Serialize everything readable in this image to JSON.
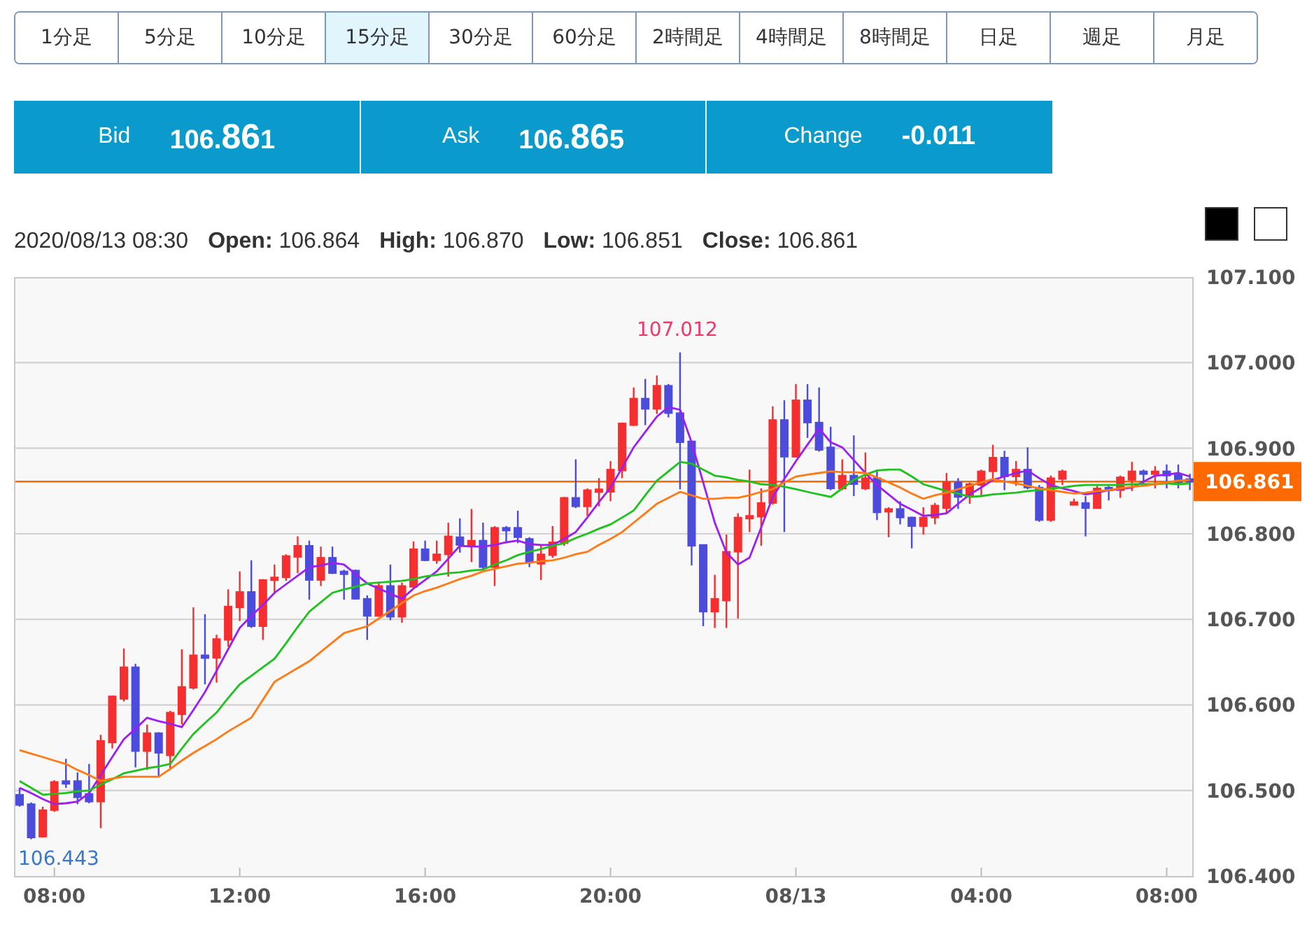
{
  "timeframe_tabs": [
    {
      "label": "1分足",
      "selected": false
    },
    {
      "label": "5分足",
      "selected": false
    },
    {
      "label": "10分足",
      "selected": false
    },
    {
      "label": "15分足",
      "selected": true
    },
    {
      "label": "30分足",
      "selected": false
    },
    {
      "label": "60分足",
      "selected": false
    },
    {
      "label": "2時間足",
      "selected": false
    },
    {
      "label": "4時間足",
      "selected": false
    },
    {
      "label": "8時間足",
      "selected": false
    },
    {
      "label": "日足",
      "selected": false
    },
    {
      "label": "週足",
      "selected": false
    },
    {
      "label": "月足",
      "selected": false
    }
  ],
  "quote_bar": [
    {
      "label": "Bid",
      "value": {
        "head": "106.",
        "pips": "86",
        "tail": "1"
      }
    },
    {
      "label": "Ask",
      "value": {
        "head": "106.",
        "pips": "86",
        "tail": "5"
      }
    },
    {
      "label": "Change",
      "value": {
        "head": "-0.011"
      }
    }
  ],
  "ohlc_info": {
    "timestamp": "2020/08/13 08:30",
    "fields": [
      {
        "label": "Open:",
        "value": "106.864"
      },
      {
        "label": "High:",
        "value": "106.870"
      },
      {
        "label": "Low:",
        "value": "106.851"
      },
      {
        "label": "Close:",
        "value": "106.861"
      }
    ]
  },
  "theme_swatches": [
    {
      "color": "#000000"
    },
    {
      "color": "#ffffff"
    }
  ],
  "chart": {
    "high_label": "107.012",
    "low_label": "106.443",
    "chart_data": {
      "type": "candlestick",
      "grid": true,
      "ylim": [
        106.4,
        107.1
      ],
      "ref_lines": [
        {
          "axis": "y",
          "value": 106.861,
          "label": "106.861",
          "color": "#ff6a00"
        }
      ],
      "yticks": [
        {
          "value": 107.1,
          "label": "107.100"
        },
        {
          "value": 107.0,
          "label": "107.000"
        },
        {
          "value": 106.9,
          "label": "106.900"
        },
        {
          "value": 106.8,
          "label": "106.800"
        },
        {
          "value": 106.7,
          "label": "106.700"
        },
        {
          "value": 106.6,
          "label": "106.600"
        },
        {
          "value": 106.5,
          "label": "106.500"
        },
        {
          "value": 106.4,
          "label": "106.400"
        }
      ],
      "categories": [
        null,
        null,
        null,
        "08:00",
        null,
        null,
        null,
        null,
        null,
        null,
        null,
        null,
        null,
        null,
        null,
        null,
        null,
        null,
        null,
        "12:00",
        null,
        null,
        null,
        null,
        null,
        null,
        null,
        null,
        null,
        null,
        null,
        null,
        null,
        null,
        null,
        "16:00",
        null,
        null,
        null,
        null,
        null,
        null,
        null,
        null,
        null,
        null,
        null,
        null,
        null,
        null,
        null,
        "20:00",
        null,
        null,
        null,
        null,
        null,
        null,
        null,
        null,
        null,
        null,
        null,
        null,
        null,
        null,
        null,
        "08/13",
        null,
        null,
        null,
        null,
        null,
        null,
        null,
        null,
        null,
        null,
        null,
        null,
        null,
        null,
        null,
        "04:00",
        null,
        null,
        null,
        null,
        null,
        null,
        null,
        null,
        null,
        null,
        null,
        null,
        null,
        null,
        null,
        "08:00",
        null,
        null
      ],
      "series": [
        {
          "ohlc": [
            [
              106.495,
              106.503,
              106.481,
              106.483
            ],
            [
              106.484,
              106.486,
              106.443,
              106.445
            ],
            [
              106.446,
              106.481,
              106.445,
              106.477
            ],
            [
              106.477,
              106.512,
              106.475,
              106.51
            ],
            [
              106.511,
              106.537,
              106.503,
              106.508
            ],
            [
              106.511,
              106.521,
              106.484,
              106.492
            ],
            [
              106.496,
              106.531,
              106.485,
              106.487
            ],
            [
              106.487,
              106.565,
              106.456,
              106.558
            ],
            [
              106.556,
              106.611,
              106.549,
              106.61
            ],
            [
              106.607,
              106.666,
              106.604,
              106.644
            ],
            [
              106.644,
              106.648,
              106.527,
              106.546
            ],
            [
              106.546,
              106.577,
              106.524,
              106.567
            ],
            [
              106.567,
              106.568,
              106.516,
              106.544
            ],
            [
              106.541,
              106.593,
              106.525,
              106.591
            ],
            [
              106.589,
              106.665,
              106.577,
              106.621
            ],
            [
              106.62,
              106.714,
              106.618,
              106.658
            ],
            [
              106.658,
              106.706,
              106.624,
              106.655
            ],
            [
              106.655,
              106.682,
              106.626,
              106.677
            ],
            [
              106.676,
              106.735,
              106.668,
              106.715
            ],
            [
              106.714,
              106.756,
              106.698,
              106.732
            ],
            [
              106.732,
              106.769,
              106.69,
              106.692
            ],
            [
              106.692,
              106.747,
              106.676,
              106.746
            ],
            [
              106.746,
              106.764,
              106.731,
              106.749
            ],
            [
              106.749,
              106.776,
              106.745,
              106.774
            ],
            [
              106.773,
              106.797,
              106.754,
              106.786
            ],
            [
              106.786,
              106.792,
              106.723,
              106.746
            ],
            [
              106.746,
              106.785,
              106.739,
              106.772
            ],
            [
              106.772,
              106.785,
              106.753,
              106.754
            ],
            [
              106.756,
              106.758,
              106.723,
              106.754
            ],
            [
              106.757,
              106.758,
              106.723,
              106.724
            ],
            [
              106.724,
              106.728,
              106.676,
              106.704
            ],
            [
              106.704,
              106.742,
              106.703,
              106.739
            ],
            [
              106.739,
              106.764,
              106.699,
              106.703
            ],
            [
              106.703,
              106.743,
              106.696,
              106.739
            ],
            [
              106.738,
              106.791,
              106.736,
              106.782
            ],
            [
              106.782,
              106.792,
              106.768,
              106.769
            ],
            [
              106.769,
              106.792,
              106.765,
              106.776
            ],
            [
              106.776,
              106.813,
              106.75,
              106.797
            ],
            [
              106.796,
              106.818,
              106.778,
              106.787
            ],
            [
              106.786,
              106.829,
              106.767,
              106.792
            ],
            [
              106.792,
              106.813,
              106.758,
              106.761
            ],
            [
              106.761,
              106.809,
              106.739,
              106.807
            ],
            [
              106.807,
              106.809,
              106.789,
              106.805
            ],
            [
              106.807,
              106.827,
              106.789,
              106.796
            ],
            [
              106.794,
              106.796,
              106.761,
              106.767
            ],
            [
              106.765,
              106.786,
              106.746,
              106.776
            ],
            [
              106.775,
              106.809,
              106.772,
              106.79
            ],
            [
              106.789,
              106.843,
              106.786,
              106.842
            ],
            [
              106.842,
              106.887,
              106.83,
              106.832
            ],
            [
              106.832,
              106.853,
              106.821,
              106.851
            ],
            [
              106.849,
              106.865,
              106.832,
              106.852
            ],
            [
              106.849,
              106.885,
              106.838,
              106.875
            ],
            [
              106.874,
              106.93,
              106.865,
              106.929
            ],
            [
              106.927,
              106.971,
              106.926,
              106.958
            ],
            [
              106.958,
              106.981,
              106.927,
              106.946
            ],
            [
              106.946,
              106.985,
              106.94,
              106.973
            ],
            [
              106.973,
              106.975,
              106.936,
              106.941
            ],
            [
              106.941,
              107.012,
              106.852,
              106.907
            ],
            [
              106.908,
              106.909,
              106.763,
              106.786
            ],
            [
              106.787,
              106.787,
              106.692,
              106.709
            ],
            [
              106.709,
              106.752,
              106.69,
              106.724
            ],
            [
              106.722,
              106.799,
              106.69,
              106.779
            ],
            [
              106.779,
              106.824,
              106.701,
              106.819
            ],
            [
              106.819,
              106.875,
              106.802,
              106.821
            ],
            [
              106.82,
              106.853,
              106.786,
              106.836
            ],
            [
              106.836,
              106.949,
              106.834,
              106.933
            ],
            [
              106.933,
              106.956,
              106.802,
              106.89
            ],
            [
              106.89,
              106.975,
              106.889,
              106.956
            ],
            [
              106.956,
              106.975,
              106.912,
              106.93
            ],
            [
              106.93,
              106.971,
              106.896,
              106.898
            ],
            [
              106.901,
              106.925,
              106.851,
              106.853
            ],
            [
              106.853,
              106.887,
              106.851,
              106.868
            ],
            [
              106.868,
              106.915,
              106.844,
              106.858
            ],
            [
              106.853,
              106.895,
              106.851,
              106.865
            ],
            [
              106.865,
              106.875,
              106.816,
              106.825
            ],
            [
              106.826,
              106.831,
              106.796,
              106.829
            ],
            [
              106.829,
              106.838,
              106.811,
              106.819
            ],
            [
              106.819,
              106.82,
              106.783,
              106.809
            ],
            [
              106.809,
              106.831,
              106.799,
              106.819
            ],
            [
              106.819,
              106.836,
              106.811,
              106.833
            ],
            [
              106.83,
              106.871,
              106.824,
              106.86
            ],
            [
              106.86,
              106.865,
              106.829,
              106.843
            ],
            [
              106.843,
              106.86,
              106.835,
              106.858
            ],
            [
              106.857,
              106.875,
              106.843,
              106.873
            ],
            [
              106.873,
              106.904,
              106.863,
              106.889
            ],
            [
              106.889,
              106.897,
              106.851,
              106.867
            ],
            [
              106.867,
              106.885,
              106.856,
              106.875
            ],
            [
              106.875,
              106.901,
              106.852,
              106.854
            ],
            [
              106.854,
              106.857,
              106.814,
              106.816
            ],
            [
              106.816,
              106.868,
              106.814,
              106.865
            ],
            [
              106.864,
              106.875,
              106.857,
              106.873
            ],
            [
              106.835,
              106.841,
              106.834,
              106.837
            ],
            [
              106.836,
              106.844,
              106.797,
              106.83
            ],
            [
              106.83,
              106.856,
              106.83,
              106.853
            ],
            [
              106.854,
              106.856,
              106.839,
              106.851
            ],
            [
              106.851,
              106.868,
              106.842,
              106.866
            ],
            [
              106.863,
              106.884,
              106.85,
              106.873
            ],
            [
              106.873,
              106.875,
              106.857,
              106.871
            ],
            [
              106.87,
              106.879,
              106.853,
              106.873
            ],
            [
              106.873,
              106.881,
              106.853,
              106.868
            ],
            [
              106.869,
              106.881,
              106.853,
              106.86
            ],
            [
              106.864,
              106.87,
              106.851,
              106.861
            ]
          ]
        },
        {
          "type": "line",
          "color": "#9b1ff0",
          "values": [
            106.503,
            106.497,
            106.49,
            106.484,
            106.485,
            106.487,
            106.497,
            106.518,
            106.539,
            106.56,
            106.572,
            106.585,
            106.581,
            106.578,
            106.574,
            106.594,
            106.615,
            106.64,
            106.665,
            106.69,
            106.704,
            106.717,
            106.731,
            106.741,
            106.751,
            106.761,
            106.763,
            106.766,
            106.764,
            106.753,
            106.742,
            106.736,
            106.73,
            106.724,
            106.736,
            106.746,
            106.756,
            106.771,
            106.786,
            106.785,
            106.785,
            106.787,
            106.79,
            106.792,
            106.788,
            106.787,
            106.787,
            106.794,
            106.802,
            106.819,
            106.837,
            106.854,
            106.877,
            106.901,
            106.919,
            106.937,
            106.948,
            106.945,
            106.907,
            106.86,
            106.813,
            106.778,
            106.764,
            106.772,
            106.807,
            106.843,
            106.864,
            106.885,
            106.904,
            106.923,
            106.907,
            106.901,
            106.886,
            106.871,
            106.857,
            106.846,
            106.835,
            106.828,
            106.821,
            106.822,
            106.824,
            106.835,
            106.846,
            106.854,
            106.863,
            106.867,
            106.871,
            106.874,
            106.865,
            106.857,
            106.853,
            106.85,
            106.846,
            106.848,
            106.851,
            106.852,
            106.854,
            106.861,
            106.868,
            106.869,
            106.871,
            106.867
          ]
        },
        {
          "type": "line",
          "color": "#1ec21e",
          "values": [
            106.511,
            106.503,
            106.495,
            106.496,
            106.497,
            106.499,
            106.5,
            106.507,
            106.513,
            106.52,
            106.523,
            106.526,
            106.528,
            106.531,
            106.549,
            106.566,
            106.579,
            106.591,
            106.608,
            106.624,
            106.634,
            106.644,
            106.654,
            106.672,
            106.691,
            106.709,
            106.72,
            106.731,
            106.735,
            106.738,
            106.742,
            106.743,
            106.744,
            106.745,
            106.747,
            106.75,
            106.752,
            106.754,
            106.755,
            106.757,
            106.758,
            106.764,
            106.769,
            106.775,
            106.779,
            106.782,
            106.786,
            106.789,
            106.795,
            106.8,
            106.806,
            106.811,
            106.819,
            106.827,
            106.845,
            106.862,
            106.873,
            106.884,
            106.882,
            106.875,
            106.868,
            106.866,
            106.863,
            106.861,
            106.858,
            106.857,
            106.855,
            106.852,
            106.849,
            106.846,
            106.843,
            106.853,
            106.863,
            106.869,
            106.874,
            106.875,
            106.875,
            106.867,
            106.858,
            106.854,
            106.85,
            106.847,
            106.843,
            106.844,
            106.846,
            106.847,
            106.848,
            106.85,
            106.851,
            106.853,
            106.854,
            106.856,
            106.857,
            106.857,
            106.857,
            106.857,
            106.858,
            106.858,
            106.858,
            106.859,
            106.858,
            106.859
          ]
        },
        {
          "type": "line",
          "color": "#ff7a14",
          "values": [
            106.547,
            106.543,
            106.539,
            106.535,
            106.531,
            106.524,
            106.518,
            106.511,
            106.514,
            106.516,
            106.516,
            106.516,
            106.516,
            106.525,
            106.535,
            106.544,
            106.552,
            106.56,
            106.569,
            106.577,
            106.585,
            106.606,
            106.627,
            106.635,
            106.643,
            106.651,
            106.662,
            106.673,
            106.684,
            106.688,
            106.692,
            106.701,
            106.71,
            106.719,
            106.728,
            106.733,
            106.737,
            106.742,
            106.747,
            106.751,
            106.756,
            106.759,
            106.762,
            106.765,
            106.766,
            106.768,
            106.769,
            106.772,
            106.776,
            106.779,
            106.787,
            106.794,
            106.802,
            106.813,
            106.824,
            106.835,
            106.842,
            106.849,
            106.845,
            106.841,
            106.841,
            106.842,
            106.842,
            106.845,
            106.849,
            106.852,
            106.86,
            106.867,
            106.869,
            106.871,
            106.873,
            106.872,
            106.872,
            106.871,
            106.866,
            106.86,
            106.854,
            106.847,
            106.841,
            106.845,
            106.848,
            106.852,
            106.856,
            106.86,
            106.864,
            106.861,
            106.859,
            106.856,
            106.853,
            106.851,
            106.849,
            106.847,
            106.848,
            106.85,
            106.851,
            106.853,
            106.855,
            106.856,
            106.858,
            106.86,
            106.862,
            106.863
          ]
        }
      ]
    }
  }
}
